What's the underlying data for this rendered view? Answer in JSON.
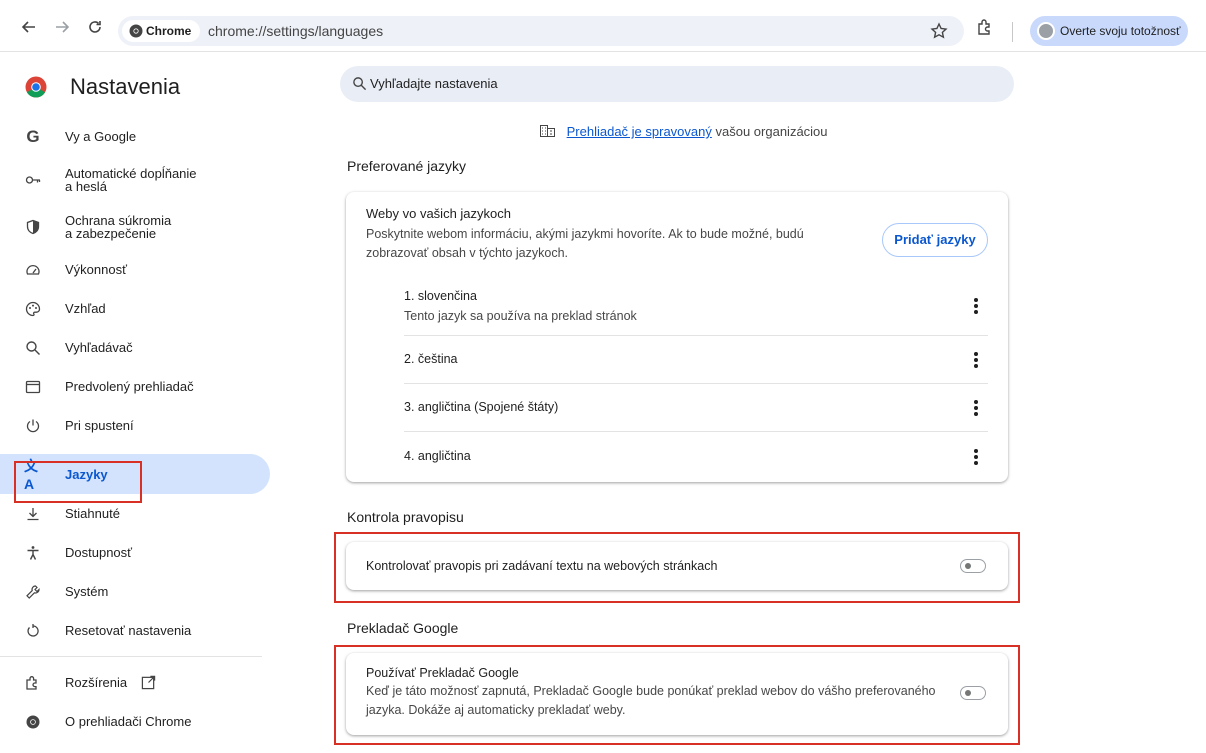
{
  "toolbar": {
    "chip_label": "Chrome",
    "url": "chrome://settings/languages",
    "profile_label": "Overte svoju totožnosť"
  },
  "sidebar": {
    "title": "Nastavenia",
    "items": [
      {
        "label": "Vy a Google",
        "icon": "google-g-icon"
      },
      {
        "label": "Automatické dopĺňanie\na heslá",
        "icon": "key-icon"
      },
      {
        "label": "Ochrana súkromia\na zabezpečenie",
        "icon": "shield-icon"
      },
      {
        "label": "Výkonnosť",
        "icon": "speedometer-icon"
      },
      {
        "label": "Vzhľad",
        "icon": "palette-icon"
      },
      {
        "label": "Vyhľadávač",
        "icon": "search-icon"
      },
      {
        "label": "Predvolený prehliadač",
        "icon": "browser-window-icon"
      },
      {
        "label": "Pri spustení",
        "icon": "power-icon"
      },
      {
        "label": "Jazyky",
        "icon": "translate-icon"
      },
      {
        "label": "Stiahnuté",
        "icon": "download-icon"
      },
      {
        "label": "Dostupnosť",
        "icon": "accessibility-icon"
      },
      {
        "label": "Systém",
        "icon": "wrench-icon"
      },
      {
        "label": "Resetovať nastavenia",
        "icon": "reset-icon"
      }
    ],
    "extensions_label": "Rozšírenia",
    "about_label": "O prehliadači Chrome"
  },
  "main": {
    "search_placeholder": "Vyhľadajte nastavenia",
    "managed_link": "Prehliadač je spravovaný",
    "managed_suffix": "vašou organizáciou",
    "preferred_title": "Preferované jazyky",
    "preferred_card": {
      "title": "Weby vo vašich jazykoch",
      "desc": "Poskytnite webom informáciu, akými jazykmi hovoríte. Ak to bude možné, budú zobrazovať obsah v týchto jazykoch.",
      "add_button": "Pridať jazyky",
      "languages": [
        {
          "name": "1. slovenčina",
          "sub": "Tento jazyk sa používa na preklad stránok"
        },
        {
          "name": "2. čeština",
          "sub": ""
        },
        {
          "name": "3. angličtina (Spojené štáty)",
          "sub": ""
        },
        {
          "name": "4. angličtina",
          "sub": ""
        }
      ]
    },
    "spellcheck_title": "Kontrola pravopisu",
    "spellcheck_label": "Kontrolovať pravopis pri zadávaní textu na webových stránkach",
    "spellcheck_enabled": false,
    "translate_title": "Prekladač Google",
    "translate_label": "Používať Prekladač Google",
    "translate_desc": "Keď je táto možnosť zapnutá, Prekladač Google bude ponúkať preklad webov do vášho preferovaného jazyka. Dokáže aj automaticky prekladať weby.",
    "translate_enabled": false
  },
  "colors": {
    "accent": "#0b57d0",
    "active_nav_bg": "#d3e3fd",
    "highlight_red": "#d93025"
  }
}
